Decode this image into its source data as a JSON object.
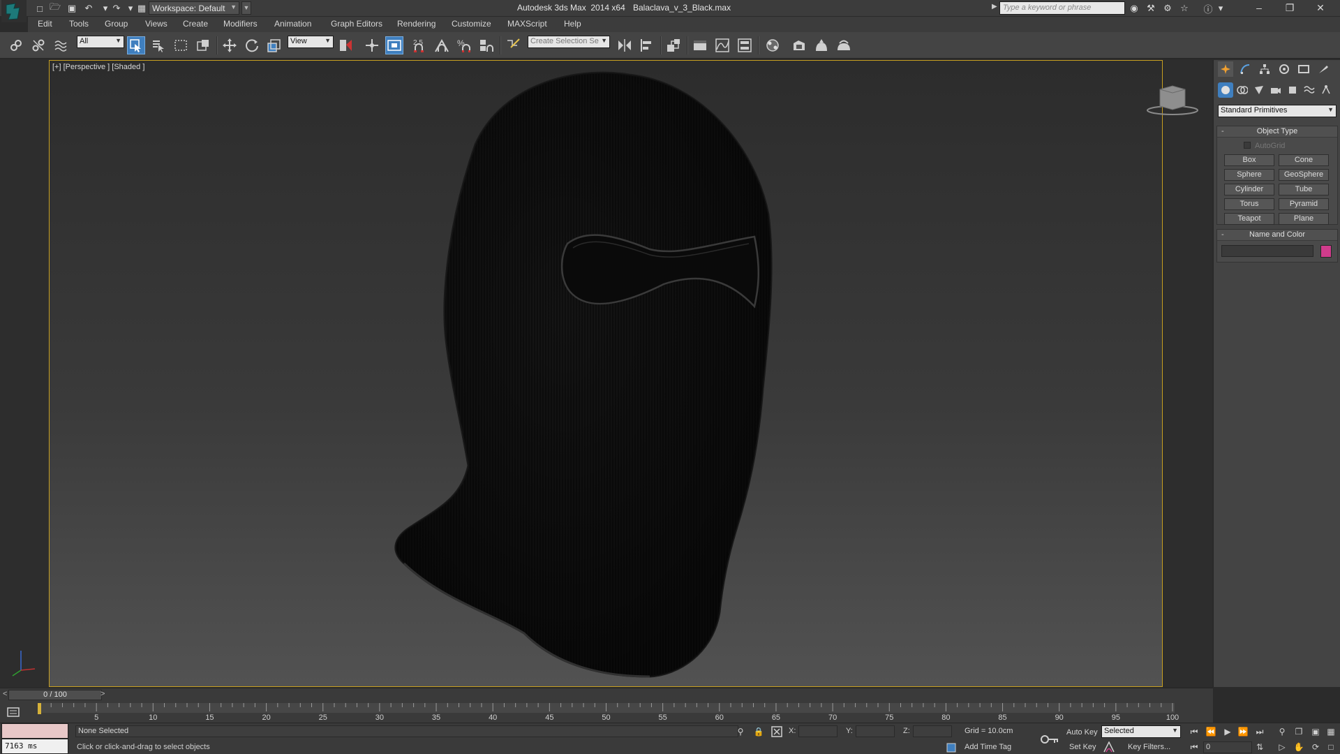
{
  "titlebar": {
    "workspace_label": "Workspace: Default",
    "app_title": "Autodesk 3ds Max  2014 x64",
    "file_name": "Balaclava_v_3_Black.max",
    "search_placeholder": "Type a keyword or phrase"
  },
  "menu": {
    "items": [
      "Edit",
      "Tools",
      "Group",
      "Views",
      "Create",
      "Modifiers",
      "Animation",
      "Graph Editors",
      "Rendering",
      "Customize",
      "MAXScript",
      "Help"
    ]
  },
  "toolbar": {
    "selection_filter": "All",
    "ref_coord": "View",
    "snap_value": "2.5",
    "named_selection_placeholder": "Create Selection Se"
  },
  "viewport": {
    "label": "[+] [Perspective ] [Shaded ]"
  },
  "command_panel": {
    "category": "Standard Primitives",
    "object_type_title": "Object Type",
    "autogrid_label": "AutoGrid",
    "primitives": [
      "Box",
      "Cone",
      "Sphere",
      "GeoSphere",
      "Cylinder",
      "Tube",
      "Torus",
      "Pyramid",
      "Teapot",
      "Plane"
    ],
    "name_color_title": "Name and Color",
    "object_color": "#d03c8c"
  },
  "timeline": {
    "frame_display": "0 / 100",
    "prev": "<",
    "next": ">",
    "ticks": [
      "5",
      "10",
      "15",
      "20",
      "25",
      "30",
      "35",
      "40",
      "45",
      "50",
      "55",
      "60",
      "65",
      "70",
      "75",
      "80",
      "85",
      "90",
      "95",
      "100"
    ]
  },
  "status": {
    "listener_output": "7163 ms",
    "selection": "None Selected",
    "prompt": "Click or click-and-drag to select objects",
    "x_label": "X:",
    "y_label": "Y:",
    "z_label": "Z:",
    "grid": "Grid = 10.0cm",
    "add_time_tag": "Add Time Tag",
    "auto_key": "Auto Key",
    "set_key": "Set Key",
    "selection_set": "Selected",
    "key_filters": "Key Filters...",
    "current_frame": "0"
  },
  "colors": {
    "viewport_border": "#c8a020",
    "active_tool": "#3f7fbf"
  }
}
